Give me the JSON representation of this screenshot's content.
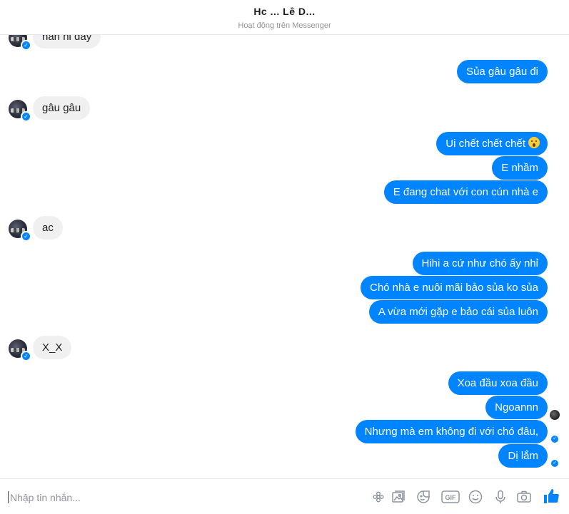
{
  "header": {
    "title": "Hc ... Lê D...",
    "subtitle": "Hoạt động trên Messenger"
  },
  "messages": [
    {
      "side": "in",
      "text": "nan nỉ đây"
    },
    {
      "side": "out",
      "text": "Sủa gâu gâu đi"
    },
    {
      "side": "in",
      "text": "gâu gâu"
    },
    {
      "side": "out",
      "text": "Ui chết chết chết"
    },
    {
      "side": "out",
      "text": "E nhầm"
    },
    {
      "side": "out",
      "text": "E đang chat với con cún nhà e"
    },
    {
      "side": "in",
      "text": "ac"
    },
    {
      "side": "out",
      "text": "Hihi a cứ như chó ấy nhỉ"
    },
    {
      "side": "out",
      "text": "Chó nhà e nuôi mãi bảo sủa ko sủa"
    },
    {
      "side": "out",
      "text": "A vừa mới gặp e bảo cái sủa luôn"
    },
    {
      "side": "in",
      "text": "X_X"
    },
    {
      "side": "out",
      "text": "Xoa đầu xoa đầu"
    },
    {
      "side": "out",
      "text": "Ngoannn"
    },
    {
      "side": "out",
      "text": "Nhưng mà em không đi với chó đâu,"
    },
    {
      "side": "out",
      "text": "Dị lắm"
    }
  ],
  "composer": {
    "placeholder": "Nhập tin nhắn...",
    "tools": [
      "flower-sticker-icon",
      "image-icon",
      "sticker-icon",
      "gif-icon",
      "emoji-icon",
      "microphone-icon",
      "camera-icon",
      "like-icon"
    ],
    "gif_label": "GIF"
  },
  "colors": {
    "accent": "#0084ff",
    "incoming_bubble": "#f1f0f0"
  }
}
